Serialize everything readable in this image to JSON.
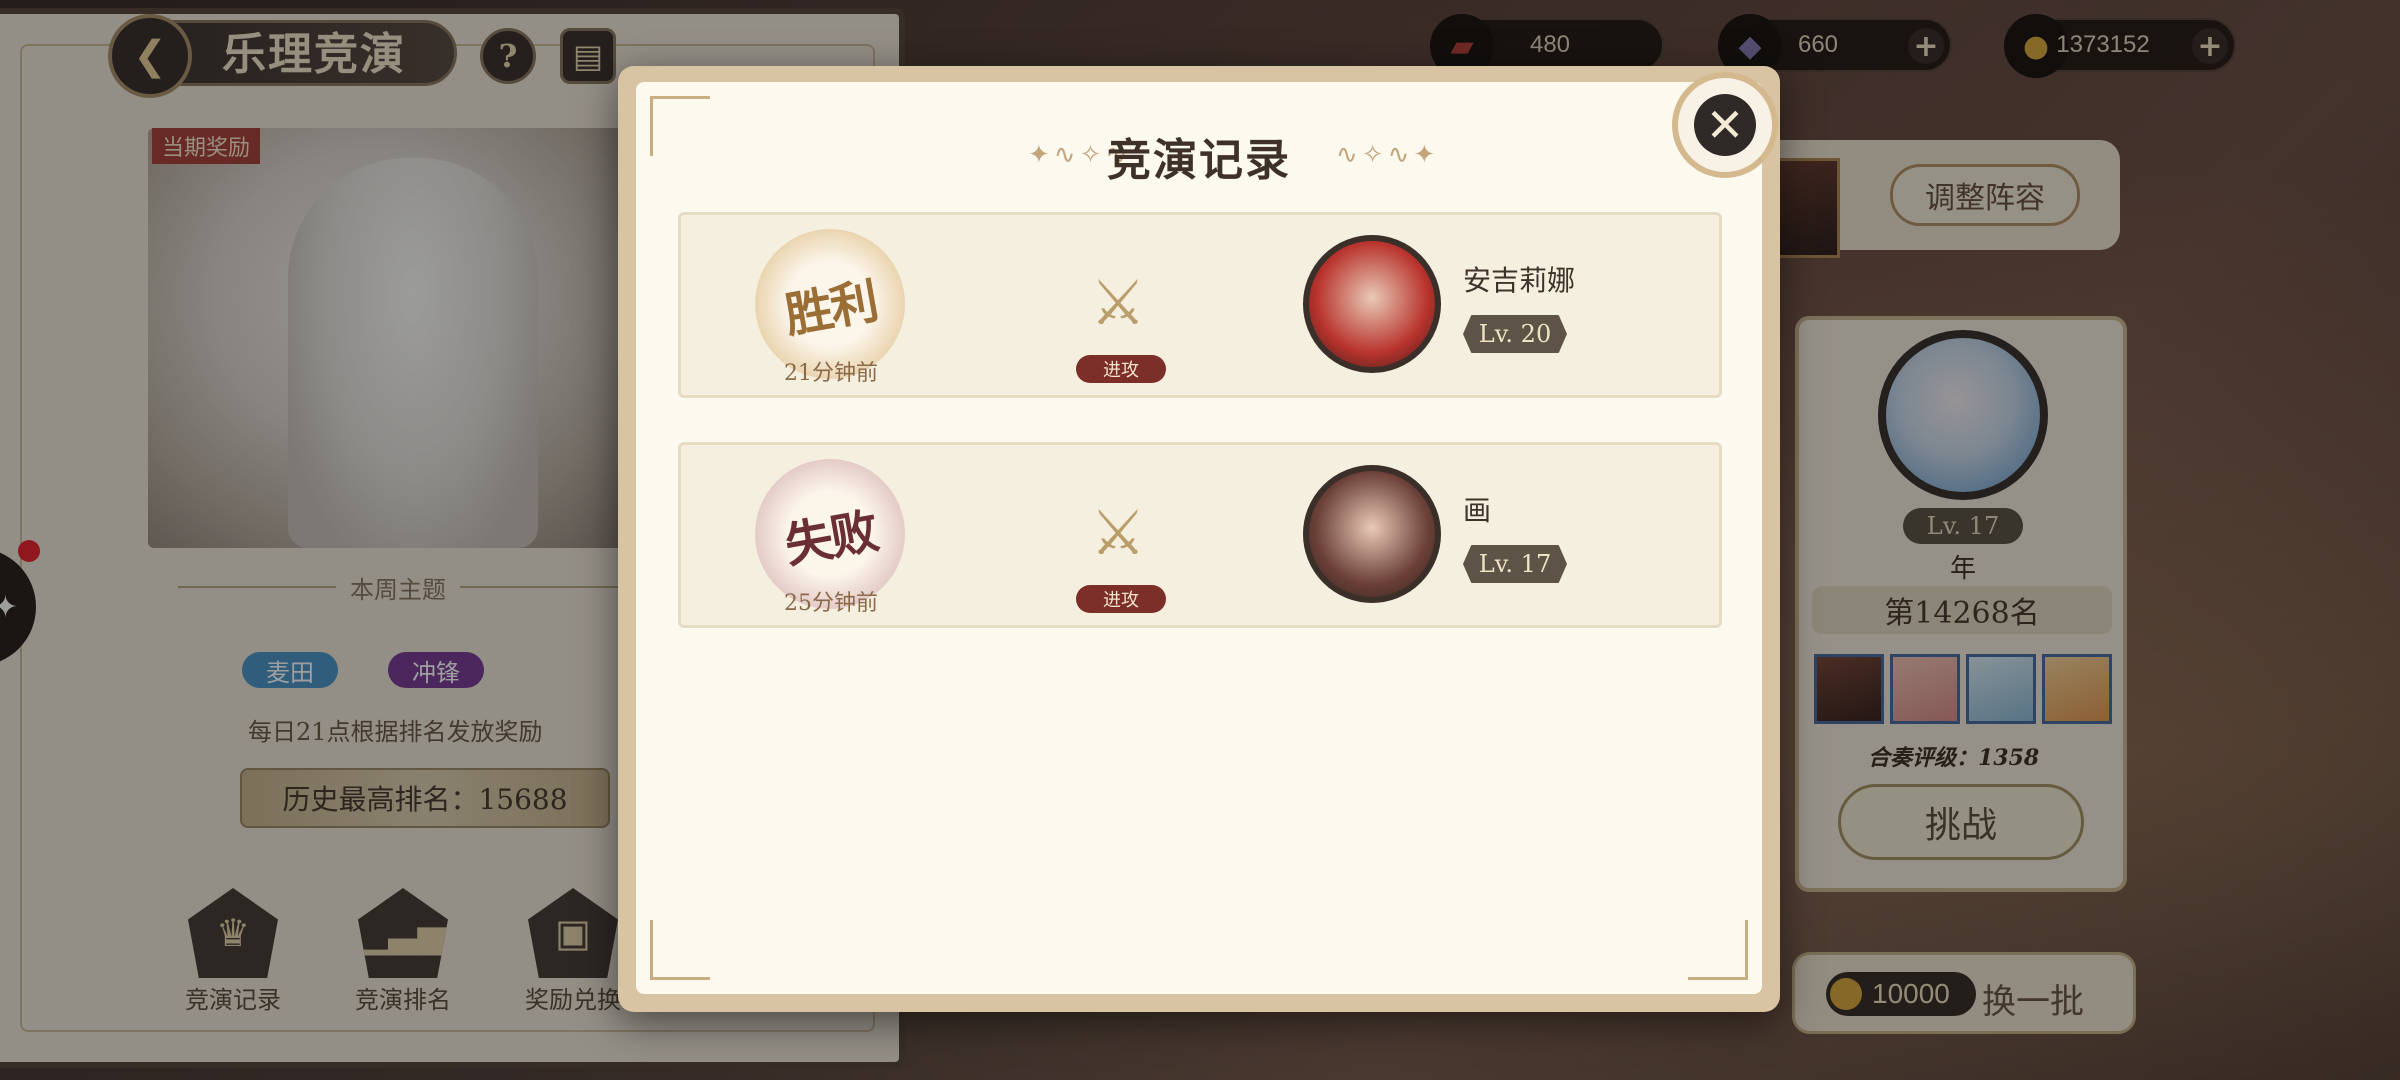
{
  "left_panel": {
    "title": "乐理竞演",
    "help_icon": "?",
    "reward_tag": "当期奖励",
    "theme_label": "本周主题",
    "tags": [
      {
        "label": "麦田",
        "color": "#4f97c9"
      },
      {
        "label": "冲锋",
        "color": "#7a3f98"
      }
    ],
    "daily_text": "每日21点根据排名发放奖励",
    "best_rank_text": "历史最高排名：15688",
    "bottom_buttons": [
      {
        "label": "竞演记录",
        "icon": "trophy-icon"
      },
      {
        "label": "竞演排名",
        "icon": "bar-chart-icon"
      },
      {
        "label": "奖励兑换",
        "icon": "gift-icon"
      }
    ]
  },
  "currencies": [
    {
      "name": "ticket",
      "value": "480",
      "has_plus": false,
      "icon_color": "#b9443b"
    },
    {
      "name": "crystal",
      "value": "660",
      "has_plus": true,
      "icon_color": "#8b7fb8"
    },
    {
      "name": "coin",
      "value": "1373152",
      "has_plus": true,
      "icon_color": "#d9a940"
    }
  ],
  "right_panel": {
    "adjust_label": "调整阵容",
    "opponent": {
      "level": "Lv. 17",
      "name": "年",
      "rank": "第14268名",
      "score": "合奏评级：1358",
      "challenge_label": "挑战"
    },
    "refresh": {
      "cost": "10000",
      "label": "换一批"
    }
  },
  "modal": {
    "title": "竞演记录",
    "records": [
      {
        "result": "胜利",
        "result_color": "#9b6e35",
        "stamp_color": "#e9d3ad",
        "time": "21分钟前",
        "action": "进攻",
        "opponent_name": "安吉莉娜",
        "opponent_level": "Lv. 20",
        "avatar_color": "#b8322c"
      },
      {
        "result": "失败",
        "result_color": "#6b2f33",
        "stamp_color": "#e3c9c6",
        "time": "25分钟前",
        "action": "进攻",
        "opponent_name": "画",
        "opponent_level": "Lv. 17",
        "avatar_color": "#6b4038"
      }
    ]
  }
}
